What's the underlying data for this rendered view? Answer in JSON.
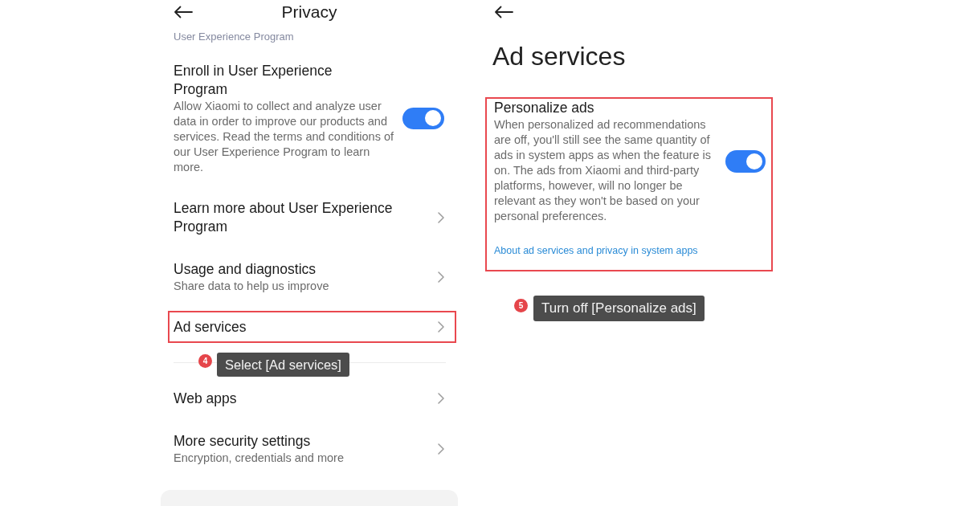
{
  "privacy_screen": {
    "title": "Privacy",
    "scrolled_text": "User Experience Program",
    "groups": [
      {
        "items": [
          {
            "kind": "toggle",
            "title": "Enroll in User Experience Program",
            "description": "Allow Xiaomi to collect and analyze user data in order to improve our products and services. Read the terms and conditions of our User Experience Program to learn more.",
            "on": true,
            "highlighted": false
          },
          {
            "kind": "link",
            "title": "Learn more about User Experience Program",
            "highlighted": false
          },
          {
            "kind": "link",
            "title": "Usage and diagnostics",
            "description": "Share data to help us improve",
            "highlighted": false
          },
          {
            "kind": "link",
            "title": "Ad services",
            "highlighted": true,
            "callout": {
              "number": "4",
              "text": "Select [Ad services]"
            }
          }
        ]
      },
      {
        "items": [
          {
            "kind": "link",
            "title": "Web apps",
            "highlighted": false
          },
          {
            "kind": "link",
            "title": "More security settings",
            "description": "Encryption, credentials and more",
            "highlighted": false
          }
        ]
      }
    ]
  },
  "ad_services_screen": {
    "title": "Ad services",
    "setting": {
      "title": "Personalize ads",
      "description": "When personalized ad recommendations are off, you'll still see the same quantity of ads in system apps as when the feature is on. The ads from Xiaomi and third-party platforms, however, will no longer be relevant as they won't be based on your personal preferences.",
      "on": true,
      "highlighted": true,
      "link": "About ad services and privacy in system apps"
    },
    "callout": {
      "number": "5",
      "text": "Turn off [Personalize ads]"
    }
  }
}
